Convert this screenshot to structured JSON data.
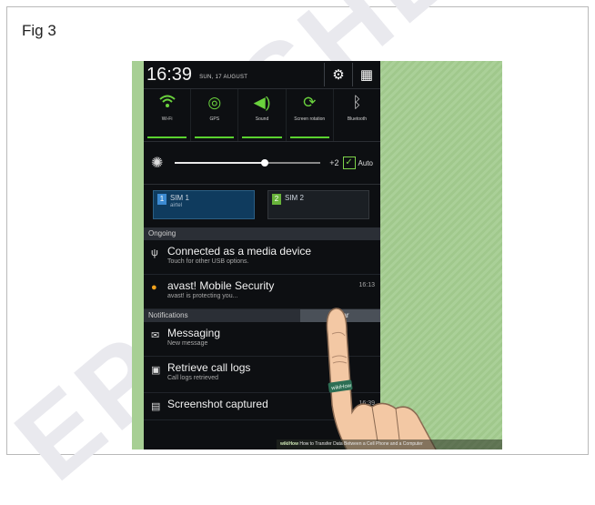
{
  "figure": {
    "label": "Fig 3"
  },
  "watermark": {
    "text_1": "EPUBLI",
    "text_2": "SHE"
  },
  "status_bar": {
    "time": "16:39",
    "date": "SUN, 17 AUGUST"
  },
  "quick_toggles": [
    {
      "label": "Wi-Fi",
      "icon": "wifi-icon",
      "on": true
    },
    {
      "label": "GPS",
      "icon": "gps-icon",
      "on": true
    },
    {
      "label": "Sound",
      "icon": "sound-icon",
      "on": true
    },
    {
      "label": "Screen rotation",
      "icon": "rotation-icon",
      "on": true
    },
    {
      "label": "Bluetooth",
      "icon": "bluetooth-icon",
      "on": false
    }
  ],
  "brightness": {
    "value": "+2",
    "auto_label": "Auto",
    "auto_checked": true,
    "level": 0.62
  },
  "sims": [
    {
      "badge": "1",
      "name": "SIM 1",
      "carrier": "airtel"
    },
    {
      "badge": "2",
      "name": "SIM 2",
      "carrier": ""
    }
  ],
  "sections": {
    "ongoing": "Ongoing",
    "notifications": "Notifications",
    "clear": "Clear"
  },
  "ongoing_items": [
    {
      "icon": "usb-icon",
      "title": "Connected as a media device",
      "subtitle": "Touch for other USB options.",
      "time": ""
    },
    {
      "icon": "avast-icon",
      "title": "avast! Mobile Security",
      "subtitle": "avast! is protecting you...",
      "time": "16:13"
    }
  ],
  "notification_items": [
    {
      "icon": "message-icon",
      "title": "Messaging",
      "subtitle": "New message",
      "time": ""
    },
    {
      "icon": "call-log-icon",
      "title": "Retrieve call logs",
      "subtitle": "Call logs retrieved",
      "time": ""
    },
    {
      "icon": "screenshot-icon",
      "title": "Screenshot captured",
      "subtitle": "",
      "time": "16:39"
    }
  ],
  "caption": {
    "brand": "wikiHow",
    "text": "How to Transfer Data Between a Cell Phone and a Computer"
  },
  "hand_ring": "wikiHow"
}
